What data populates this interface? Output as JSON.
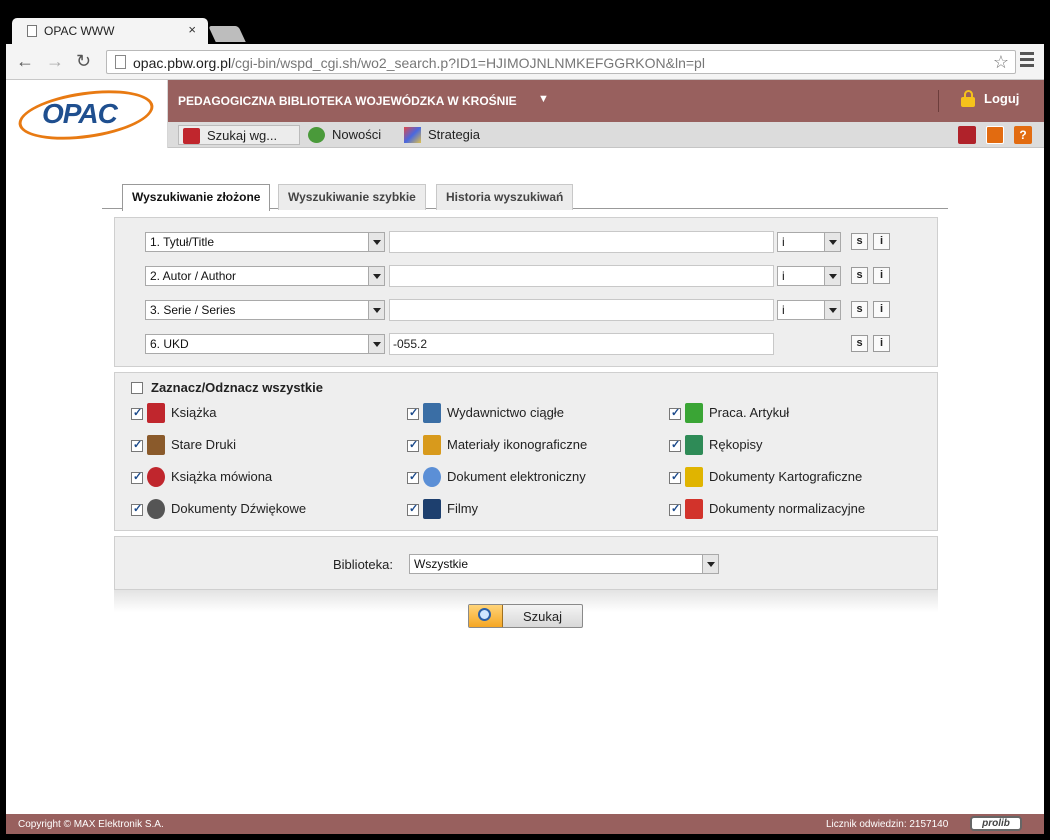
{
  "browser": {
    "tab_title": "OPAC WWW",
    "tab_close": "×",
    "url_host": "opac.pbw.org.pl",
    "url_path": "/cgi-bin/wspd_cgi.sh/wo2_search.p?ID1=HJIMOJNLNMKEFGGRKON&ln=pl",
    "back_icon": "back-arrow-icon",
    "forward_icon": "forward-arrow-icon",
    "reload_icon": "reload-icon",
    "star_icon": "bookmark-star-icon"
  },
  "header": {
    "logo_text": "OPAC",
    "library_name": "PEDAGOGICZNA BIBLIOTEKA WOJEWÓDZKA W KROŚNIE",
    "library_caret": "▼",
    "login_label": "Loguj"
  },
  "menubar": {
    "items": [
      {
        "label": "Szukaj wg...",
        "icon": "search-book-icon"
      },
      {
        "label": "Nowości",
        "icon": "new-items-icon"
      },
      {
        "label": "Strategia",
        "icon": "strategy-icon"
      }
    ],
    "tools": [
      "books-icon",
      "home-icon",
      "help-icon"
    ],
    "help_label": "?"
  },
  "search_tabs": [
    {
      "label": "Wyszukiwanie złożone",
      "active": true
    },
    {
      "label": "Wyszukiwanie szybkie",
      "active": false
    },
    {
      "label": "Historia wyszukiwań",
      "active": false
    }
  ],
  "search_rows": [
    {
      "field": "1. Tytuł/Title",
      "value": "",
      "operator": "i"
    },
    {
      "field": "2. Autor / Author",
      "value": "",
      "operator": "i"
    },
    {
      "field": "3. Serie / Series",
      "value": "",
      "operator": "i"
    },
    {
      "field": "6. UKD",
      "value": "-055.2",
      "operator": ""
    }
  ],
  "row_buttons": {
    "s": "s",
    "i": "i"
  },
  "materials": {
    "toggle_all_label": "Zaznacz/Odznacz wszystkie",
    "items": [
      {
        "label": "Książka",
        "checked": true,
        "icon": "book-icon",
        "color": "#c0262d"
      },
      {
        "label": "Wydawnictwo ciągłe",
        "checked": true,
        "icon": "periodical-icon",
        "color": "#3a6ea5"
      },
      {
        "label": "Praca. Artykuł",
        "checked": true,
        "icon": "article-icon",
        "color": "#3aa535"
      },
      {
        "label": "Stare Druki",
        "checked": true,
        "icon": "old-prints-icon",
        "color": "#8a5a2b"
      },
      {
        "label": "Materiały ikonograficzne",
        "checked": true,
        "icon": "iconography-icon",
        "color": "#d89a1c"
      },
      {
        "label": "Rękopisy",
        "checked": true,
        "icon": "manuscript-icon",
        "color": "#2e8b57"
      },
      {
        "label": "Książka mówiona",
        "checked": true,
        "icon": "audiobook-icon",
        "color": "#c0262d"
      },
      {
        "label": "Dokument elektroniczny",
        "checked": true,
        "icon": "cd-icon",
        "color": "#5b8fd6"
      },
      {
        "label": "Dokumenty Kartograficzne",
        "checked": true,
        "icon": "map-icon",
        "color": "#e0b400"
      },
      {
        "label": "Dokumenty Dźwiękowe",
        "checked": true,
        "icon": "audio-disc-icon",
        "color": "#555555"
      },
      {
        "label": "Filmy",
        "checked": true,
        "icon": "film-icon",
        "color": "#1d3f6e"
      },
      {
        "label": "Dokumenty normalizacyjne",
        "checked": true,
        "icon": "pdf-standard-icon",
        "color": "#d2332b"
      }
    ]
  },
  "library": {
    "label": "Biblioteka:",
    "value": "Wszystkie"
  },
  "search_button": "Szukaj",
  "footer": {
    "copyright": "Copyright © MAX Elektronik S.A.",
    "counter": "Licznik odwiedzin: 2157140",
    "brand": "prolib"
  },
  "colors": {
    "banner": "#98605e",
    "accent_orange": "#e87a12",
    "logo_blue": "#1f4f8f"
  }
}
